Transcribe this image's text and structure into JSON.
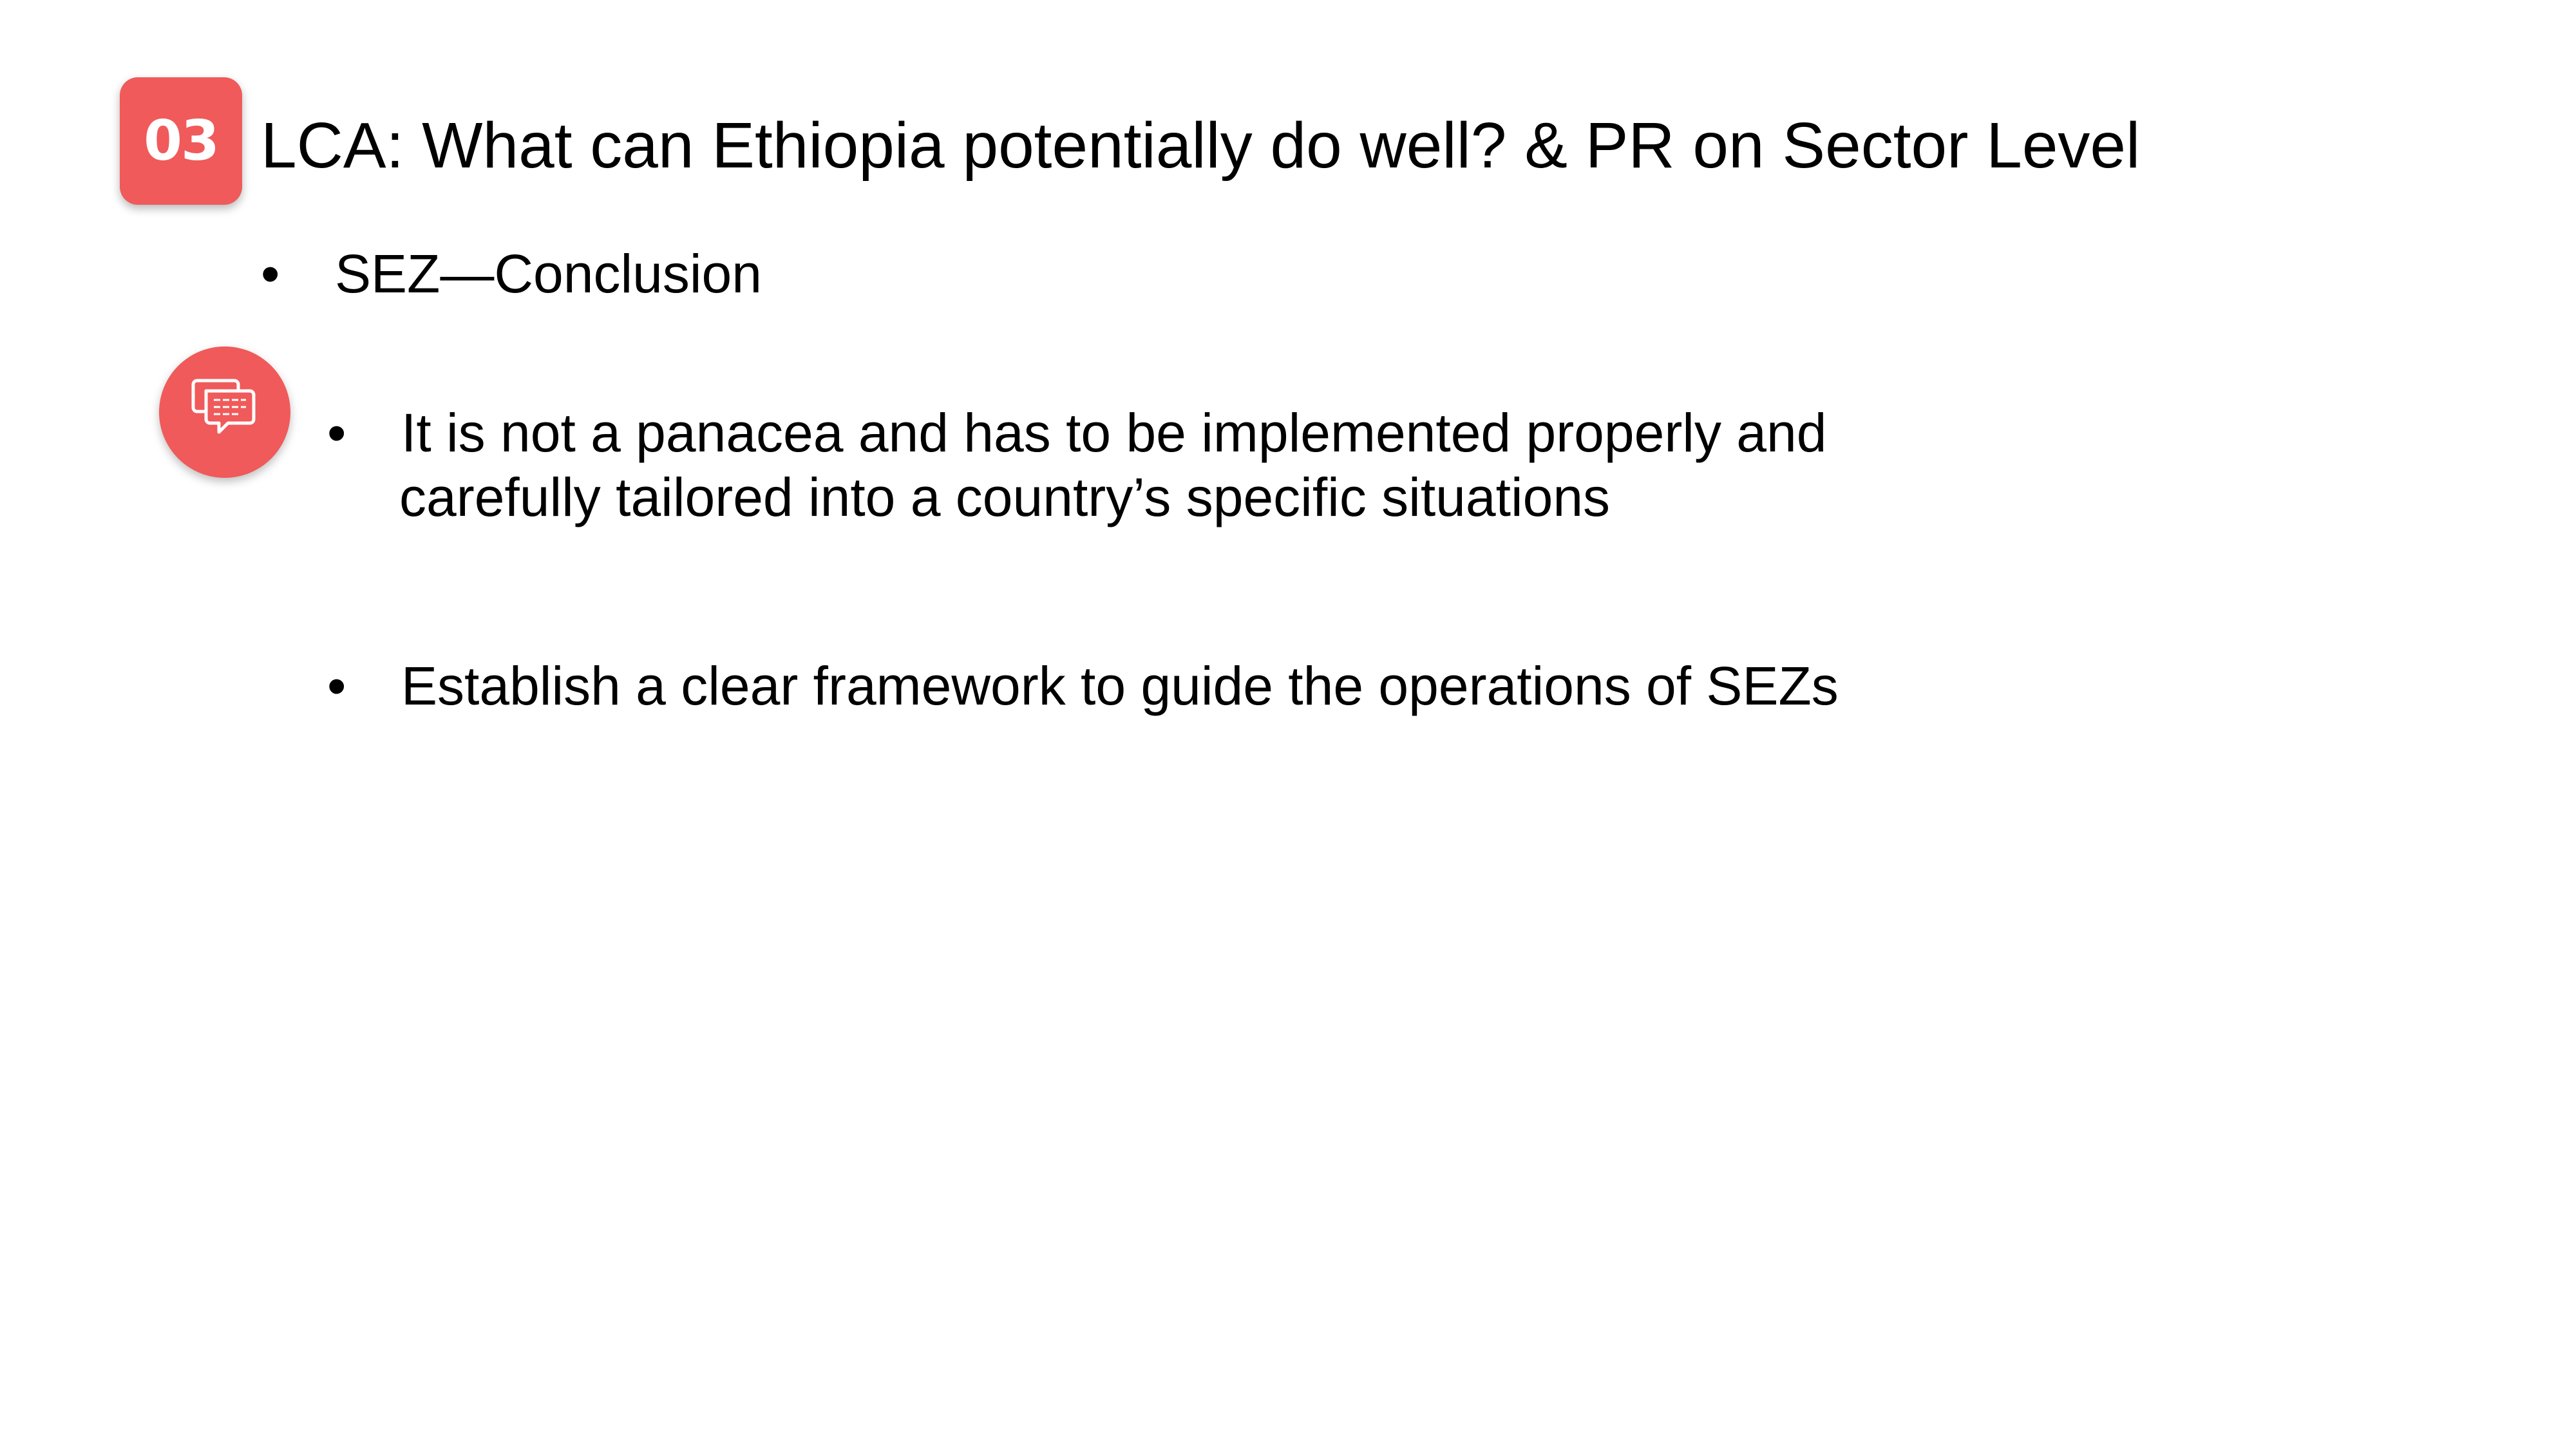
{
  "section": {
    "number": "03"
  },
  "slide": {
    "title": "LCA: What can Ethiopia potentially do well? & PR on Sector Level"
  },
  "bullets": {
    "marker": "•",
    "heading": "SEZ—Conclusion",
    "points": [
      {
        "line1": "It is not a panacea and has to be implemented properly and",
        "line2": "carefully tailored into a country’s specific situations"
      },
      {
        "line1": "Establish a clear framework to guide the operations of SEZs"
      }
    ]
  },
  "icons": {
    "comment": "speech-bubbles-icon"
  },
  "colors": {
    "accent": "#f05a5a",
    "text": "#000000",
    "background": "#ffffff"
  }
}
